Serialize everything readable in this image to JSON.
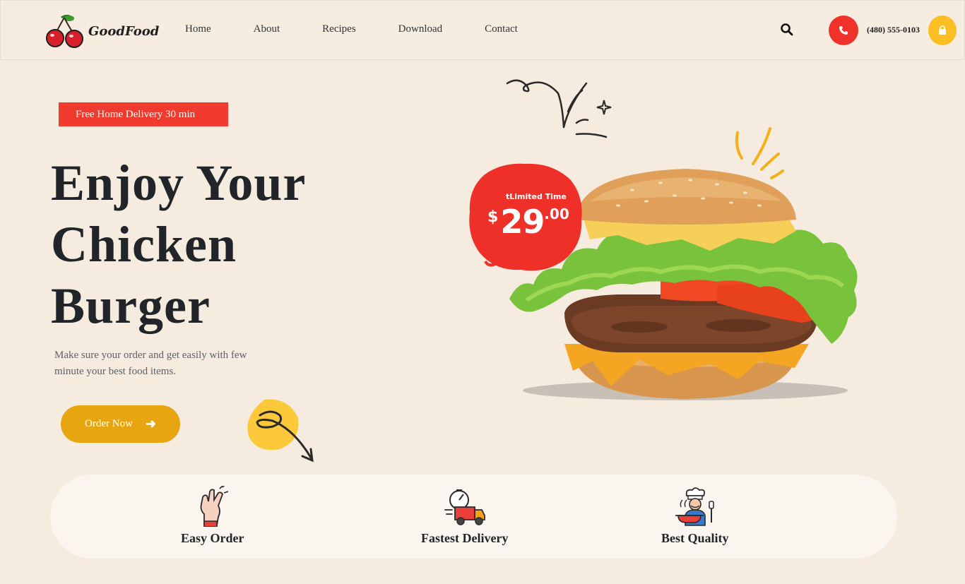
{
  "header": {
    "logo_text": "GoodFood",
    "nav": [
      "Home",
      "About",
      "Recipes",
      "Download",
      "Contact"
    ],
    "phone": "(480) 555-0103",
    "icons": {
      "search": "search-icon",
      "phone": "phone-icon",
      "bag": "shopping-bag-icon",
      "logo": "cherry-icon"
    }
  },
  "hero": {
    "badge": "Free Home Delivery 30 min",
    "title_lines": [
      "Enjoy Your",
      "Chicken",
      "Burger"
    ],
    "description": "Make sure your order and get easily with few minute your best food items.",
    "order_button": "Order Now"
  },
  "price_tag": {
    "label": "tLimited Time",
    "currency": "$",
    "amount": "29",
    "cents": ".00"
  },
  "features": [
    {
      "label": "Easy Order",
      "icon": "hand-snap-icon"
    },
    {
      "label": "Fastest Delivery",
      "icon": "delivery-truck-icon"
    },
    {
      "label": "Best Quality",
      "icon": "chef-icon"
    }
  ],
  "colors": {
    "background": "#f5ebde",
    "accent_red": "#ef3a2d",
    "accent_yellow": "#fbbf24",
    "button_gold": "#e7a611"
  }
}
